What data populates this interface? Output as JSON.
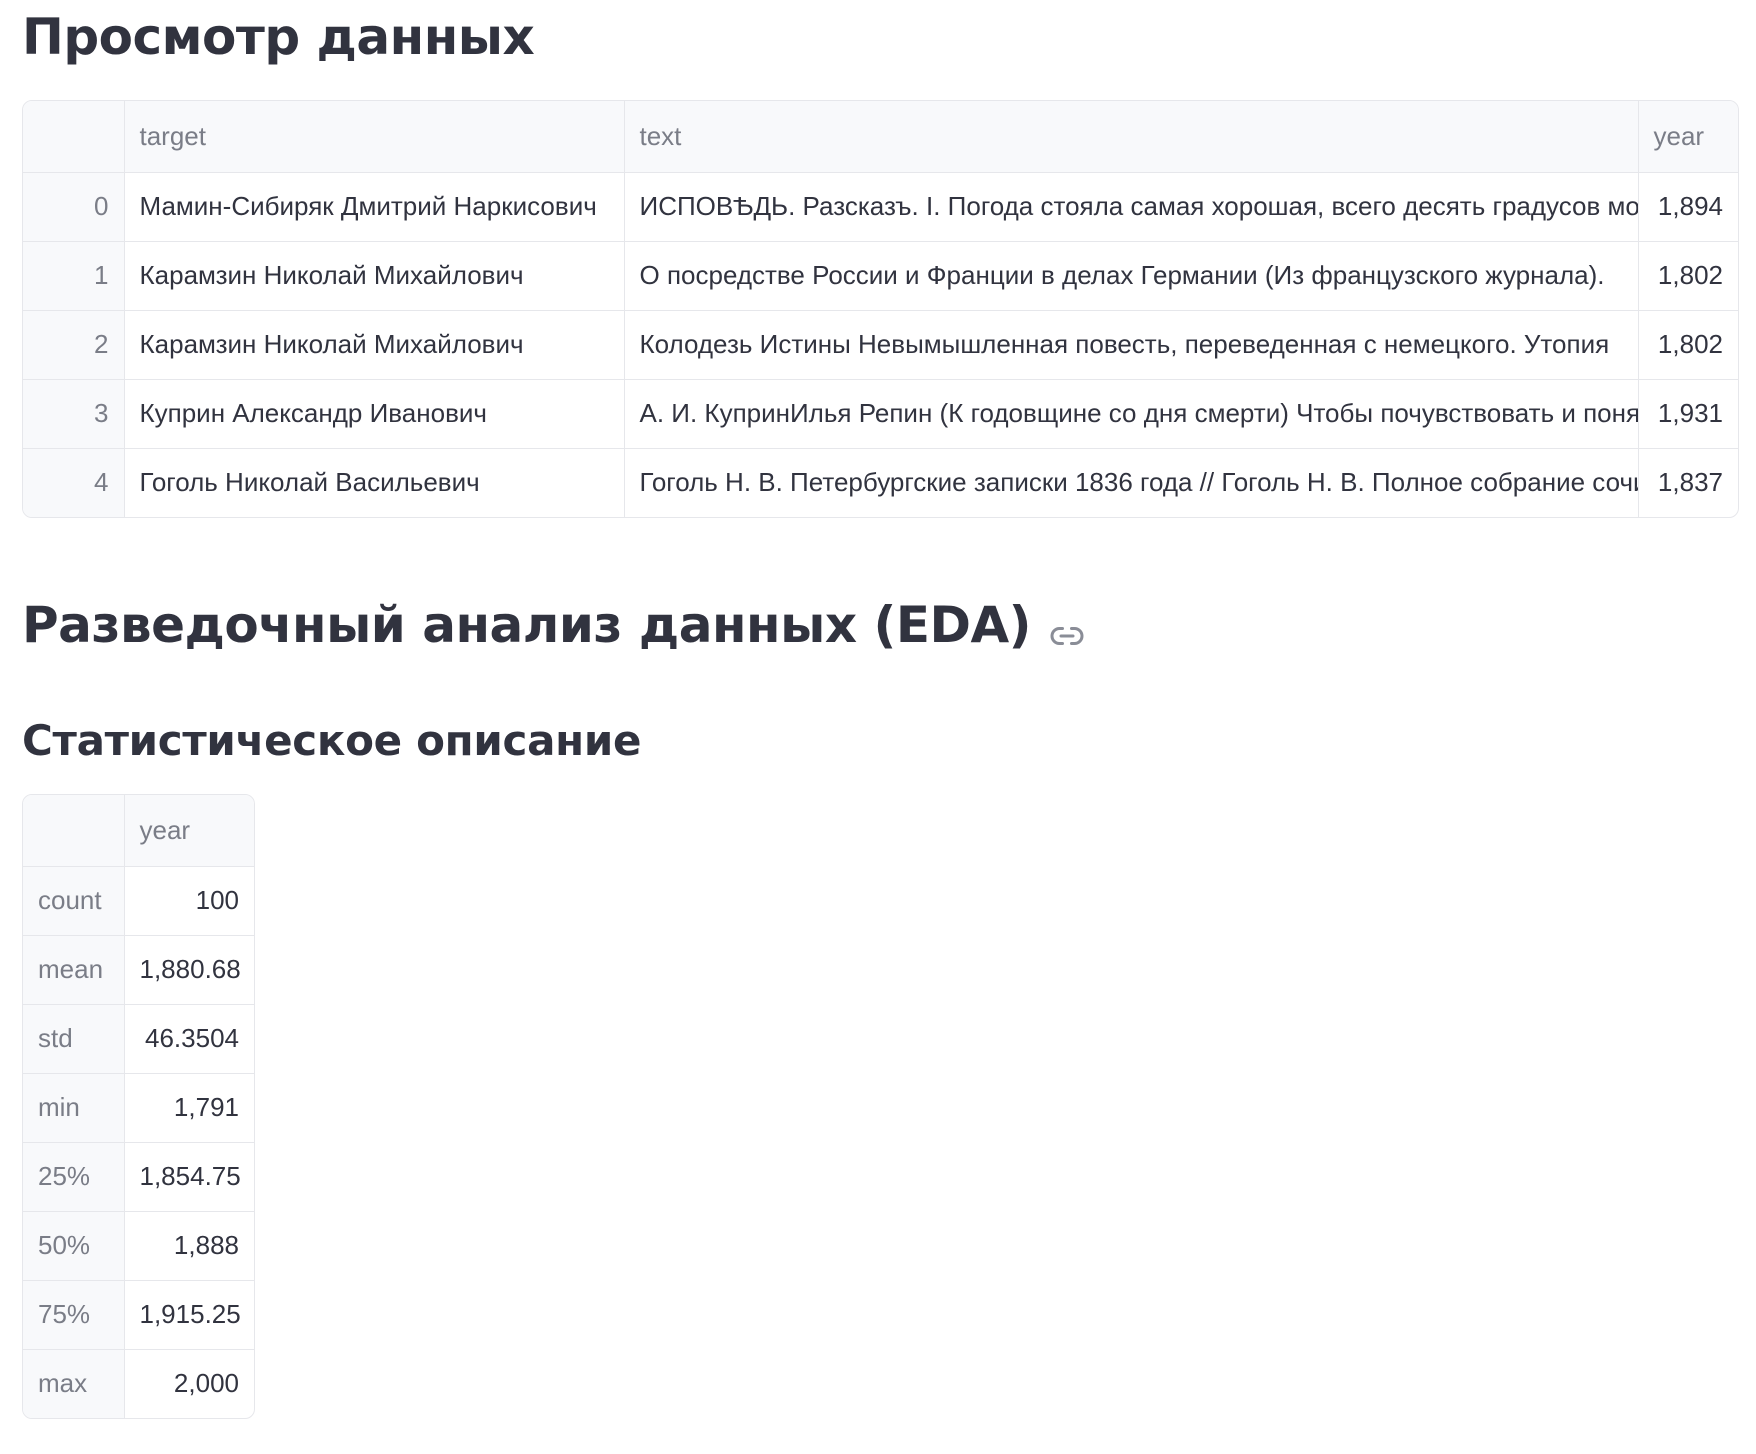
{
  "preview": {
    "title": "Просмотр данных",
    "columns": [
      "",
      "target",
      "text",
      "year"
    ],
    "rows": [
      {
        "index": "0",
        "target": "Мамин-Сибиряк Дмитрий Наркисович",
        "text": "    ИСПОВѢДЬ. Разсказъ. I.    Погода стояла самая хорошая, всего десять градусов мороза",
        "year": "1,894"
      },
      {
        "index": "1",
        "target": "Карамзин Николай Михайлович",
        "text": " О посредстве России и Франции в делах Германии (Из французского журнала).",
        "year": "1,802"
      },
      {
        "index": "2",
        "target": "Карамзин Николай Михайлович",
        "text": " Колодезь Истины Невымышленная повесть, переведенная с немецкого.    Утопия",
        "year": "1,802"
      },
      {
        "index": "3",
        "target": "Куприн Александр Иванович",
        "text": " А. И. КупринИлья Репин (К годовщине со дня смерти)    Чтобы почувствовать и понять",
        "year": "1,931"
      },
      {
        "index": "4",
        "target": "Гоголь Николай Васильевич",
        "text": "   Гоголь Н. В. Петербургские записки 1836 года // Гоголь Н. В. Полное собрание сочинений",
        "year": "1,837"
      }
    ]
  },
  "eda": {
    "title": "Разведочный анализ данных (EDA)",
    "link_icon": "link-icon"
  },
  "stats": {
    "title": "Статистическое описание",
    "columns": [
      "",
      "year"
    ],
    "rows": [
      {
        "stat": "count",
        "value": "100"
      },
      {
        "stat": "mean",
        "value": "1,880.68"
      },
      {
        "stat": "std",
        "value": "46.3504"
      },
      {
        "stat": "min",
        "value": "1,791"
      },
      {
        "stat": "25%",
        "value": "1,854.75"
      },
      {
        "stat": "50%",
        "value": "1,888"
      },
      {
        "stat": "75%",
        "value": "1,915.25"
      },
      {
        "stat": "max",
        "value": "2,000"
      }
    ]
  }
}
